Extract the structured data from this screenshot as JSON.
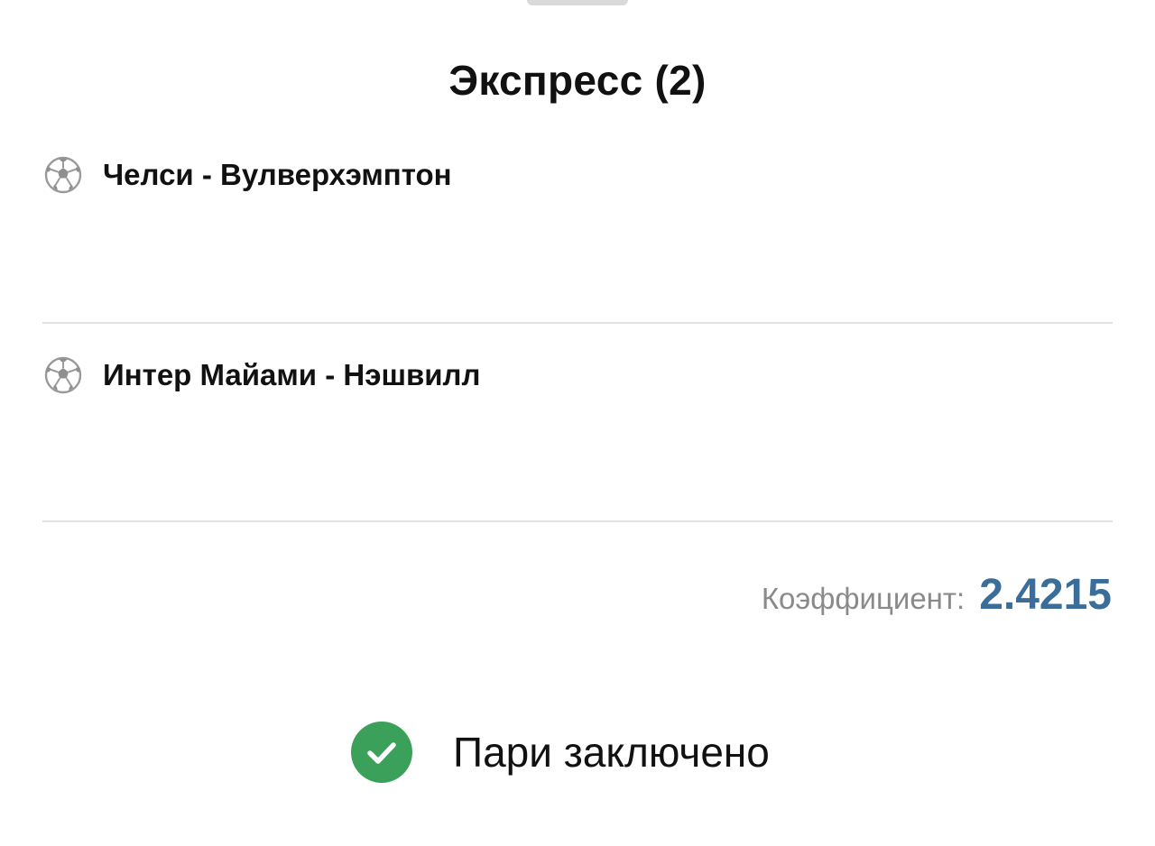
{
  "sheet": {
    "title": "Экспресс (2)"
  },
  "events": [
    {
      "icon": "soccer-ball-icon",
      "name": "Челси - Вулверхэмптон"
    },
    {
      "icon": "soccer-ball-icon",
      "name": "Интер Майами - Нэшвилл"
    }
  ],
  "odds": {
    "label": "Коэффициент:",
    "value": "2.4215"
  },
  "status": {
    "icon": "check-circle-icon",
    "text": "Пари заключено"
  },
  "colors": {
    "accent": "#3b6d9a",
    "success": "#3aa05a",
    "muted": "#8a8a8a",
    "divider": "#e3e3e3"
  }
}
